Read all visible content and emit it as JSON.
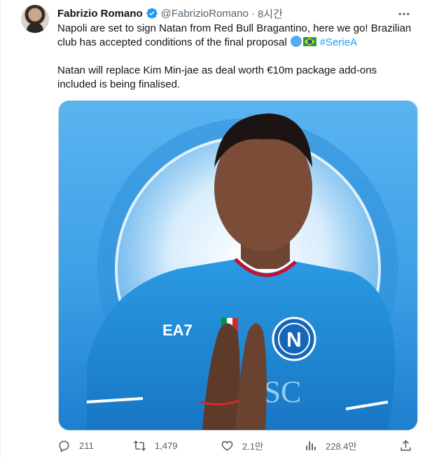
{
  "tweet": {
    "author_name": "Fabrizio Romano",
    "handle": "@FabrizioRomano",
    "separator": "·",
    "time": "8시간",
    "text_line1": "Napoli are set to sign Natan from Red Bull Bragantino, here we go! Brazilian club has accepted conditions of the final proposal",
    "hashtag": "#SerieA",
    "text_paragraph2": "Natan will replace Kim Min-jae as deal worth €10m package add-ons included is being finalised."
  },
  "media": {
    "shirt_sponsor": "EA7",
    "crest_letter": "N",
    "shirt_text": "SSC"
  },
  "actions": {
    "replies": "211",
    "retweets": "1,479",
    "likes": "2.1만",
    "views": "228.4만"
  },
  "colors": {
    "accent": "#1d9bf0",
    "muted": "#536471",
    "napoli_blue": "#1b8fd8"
  },
  "icons": [
    "verified-badge-icon",
    "more-options-icon",
    "blue-circle-emoji-icon",
    "brazil-flag-emoji-icon",
    "reply-icon",
    "retweet-icon",
    "like-icon",
    "views-icon",
    "share-icon"
  ]
}
